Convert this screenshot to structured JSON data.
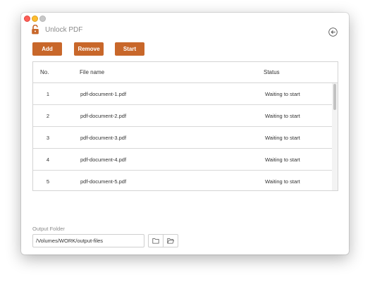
{
  "window": {
    "title": "Unlock PDF"
  },
  "icons": {
    "app": "unlock-icon",
    "back": "back-arrow-icon",
    "folder": "folder-icon",
    "open_folder": "open-folder-icon"
  },
  "toolbar": {
    "add_label": "Add",
    "remove_label": "Remove",
    "start_label": "Start"
  },
  "table": {
    "headers": {
      "no": "No.",
      "file_name": "File name",
      "status": "Status"
    },
    "rows": [
      {
        "no": "1",
        "file_name": "pdf-document-1.pdf",
        "status": "Waiting to start"
      },
      {
        "no": "2",
        "file_name": "pdf-document-2.pdf",
        "status": "Waiting to start"
      },
      {
        "no": "3",
        "file_name": "pdf-document-3.pdf",
        "status": "Waiting to start"
      },
      {
        "no": "4",
        "file_name": "pdf-document-4.pdf",
        "status": "Waiting to start"
      },
      {
        "no": "5",
        "file_name": "pdf-document-5.pdf",
        "status": "Waiting to start"
      }
    ]
  },
  "output": {
    "label": "Output Folder",
    "path": "/Volumes/WORK/output-files"
  },
  "colors": {
    "accent": "#c8672a",
    "close": "#fe5f57",
    "minimize": "#febc2e",
    "zoom_disabled": "#c8c8c8"
  }
}
